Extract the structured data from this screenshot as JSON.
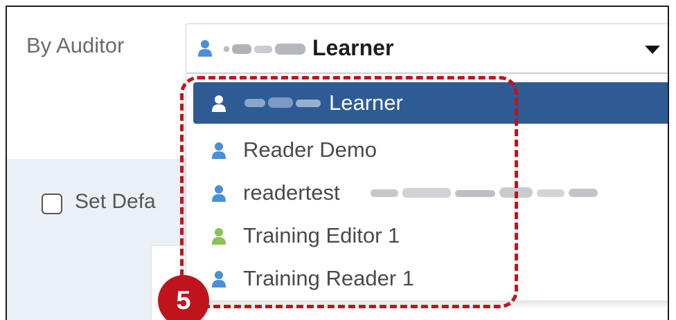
{
  "filter": {
    "label": "By Auditor",
    "selected_value": "Learner"
  },
  "default_checkbox": {
    "label": "Set Defa"
  },
  "dropdown": {
    "options": [
      {
        "label": "Learner",
        "icon": "user-icon",
        "icon_color": "#ffffff",
        "selected": true
      },
      {
        "label": "Reader Demo",
        "icon": "user-icon",
        "icon_color": "#4a8fd8",
        "selected": false
      },
      {
        "label": "readertest",
        "icon": "user-icon",
        "icon_color": "#4a8fd8",
        "selected": false
      },
      {
        "label": "Training Editor 1",
        "icon": "user-icon",
        "icon_color": "#8cc152",
        "selected": false
      },
      {
        "label": "Training Reader 1",
        "icon": "user-icon",
        "icon_color": "#4a8fd8",
        "selected": false
      }
    ]
  },
  "annotation": {
    "step_number": "5",
    "color": "#c0141c"
  },
  "colors": {
    "selected_bg": "#2f5b94",
    "user_blue": "#4a8fd8",
    "user_green": "#8cc152"
  }
}
